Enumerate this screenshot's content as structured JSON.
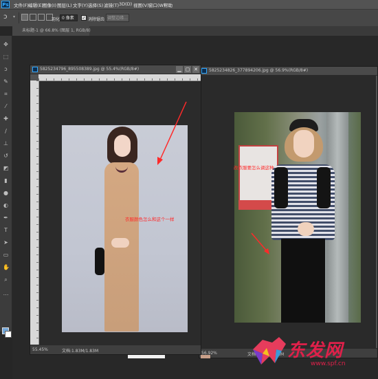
{
  "app": {
    "logo": "Ps"
  },
  "menu": [
    "文件(F)",
    "编辑(E)",
    "图像(I)",
    "图层(L)",
    "文字(Y)",
    "选择(S)",
    "滤镜(T)",
    "3D(D)",
    "视图(V)",
    "窗口(W)",
    "帮助"
  ],
  "options": {
    "feather_label": "羽化:",
    "feather_value": "0 像素",
    "antialias_label": "消除锯齿",
    "refine_label": "调整边缘..."
  },
  "document_tab": "未标题-1 @ 66.8% (图层 1, RGB/8)",
  "windows": [
    {
      "title": "5825234796_895508389.jpg @ 55.4%(RGB/8#)",
      "zoom": "55.45%",
      "doc_info": "文档:1.83M/1.83M",
      "annotation": "衣服颜色怎么和这个一样"
    },
    {
      "title": "5825234826_377894206.jpg @ 56.9%(RGB/8#)",
      "zoom": "56.92%",
      "doc_info": "文档:1.83M/1.83M",
      "annotation": "改衣服要怎么调这种"
    }
  ],
  "watermark": {
    "text": "东发网",
    "url": "www.spf.cn"
  },
  "colors": {
    "foreground": "#73a7d9",
    "background": "#ffffff",
    "annotation": "#ff2a2a",
    "watermark": "#e0204a"
  }
}
